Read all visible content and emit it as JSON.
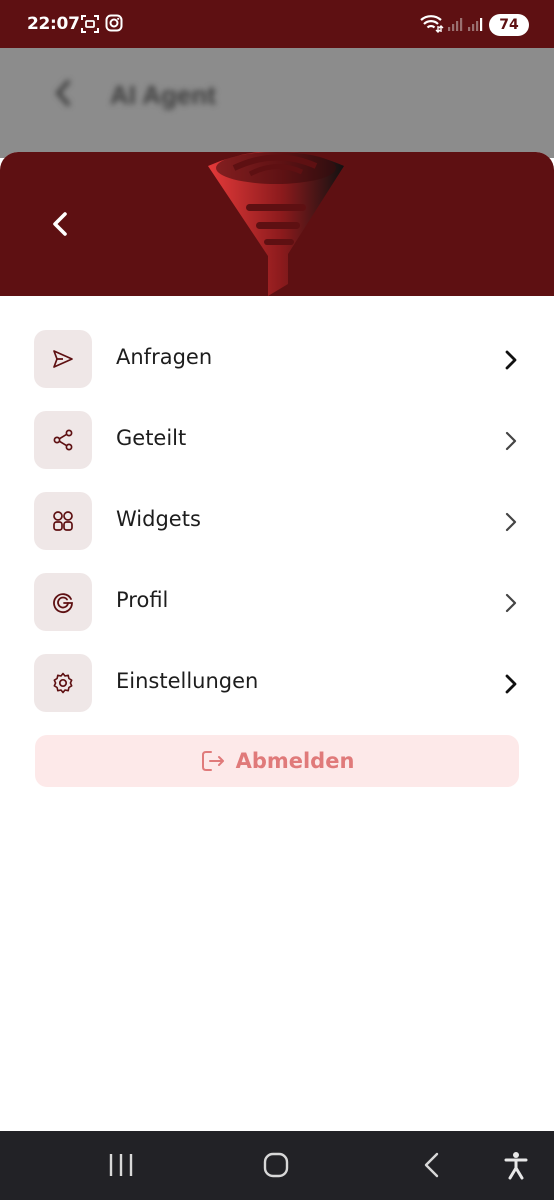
{
  "status_bar": {
    "time": "22:07",
    "battery": "74",
    "icons": [
      "screenshot-icon",
      "instagram-icon",
      "wifi-icon",
      "signal-icon",
      "signal-icon",
      "battery-icon"
    ]
  },
  "background_page": {
    "title": "AI Agent"
  },
  "menu": {
    "items": [
      {
        "label": "Anfragen",
        "icon": "send-icon"
      },
      {
        "label": "Geteilt",
        "icon": "share-icon"
      },
      {
        "label": "Widgets",
        "icon": "widgets-icon"
      },
      {
        "label": "Profil",
        "icon": "profile-g-icon"
      },
      {
        "label": "Einstellungen",
        "icon": "settings-gear-icon"
      }
    ]
  },
  "logout": {
    "label": "Abmelden",
    "icon": "logout-icon"
  },
  "colors": {
    "header": "#5e1012",
    "icon_tile": "#efe7e7",
    "logout_bg": "#fde9e9",
    "logout_text": "#e07a7a",
    "navbar": "#222226"
  }
}
